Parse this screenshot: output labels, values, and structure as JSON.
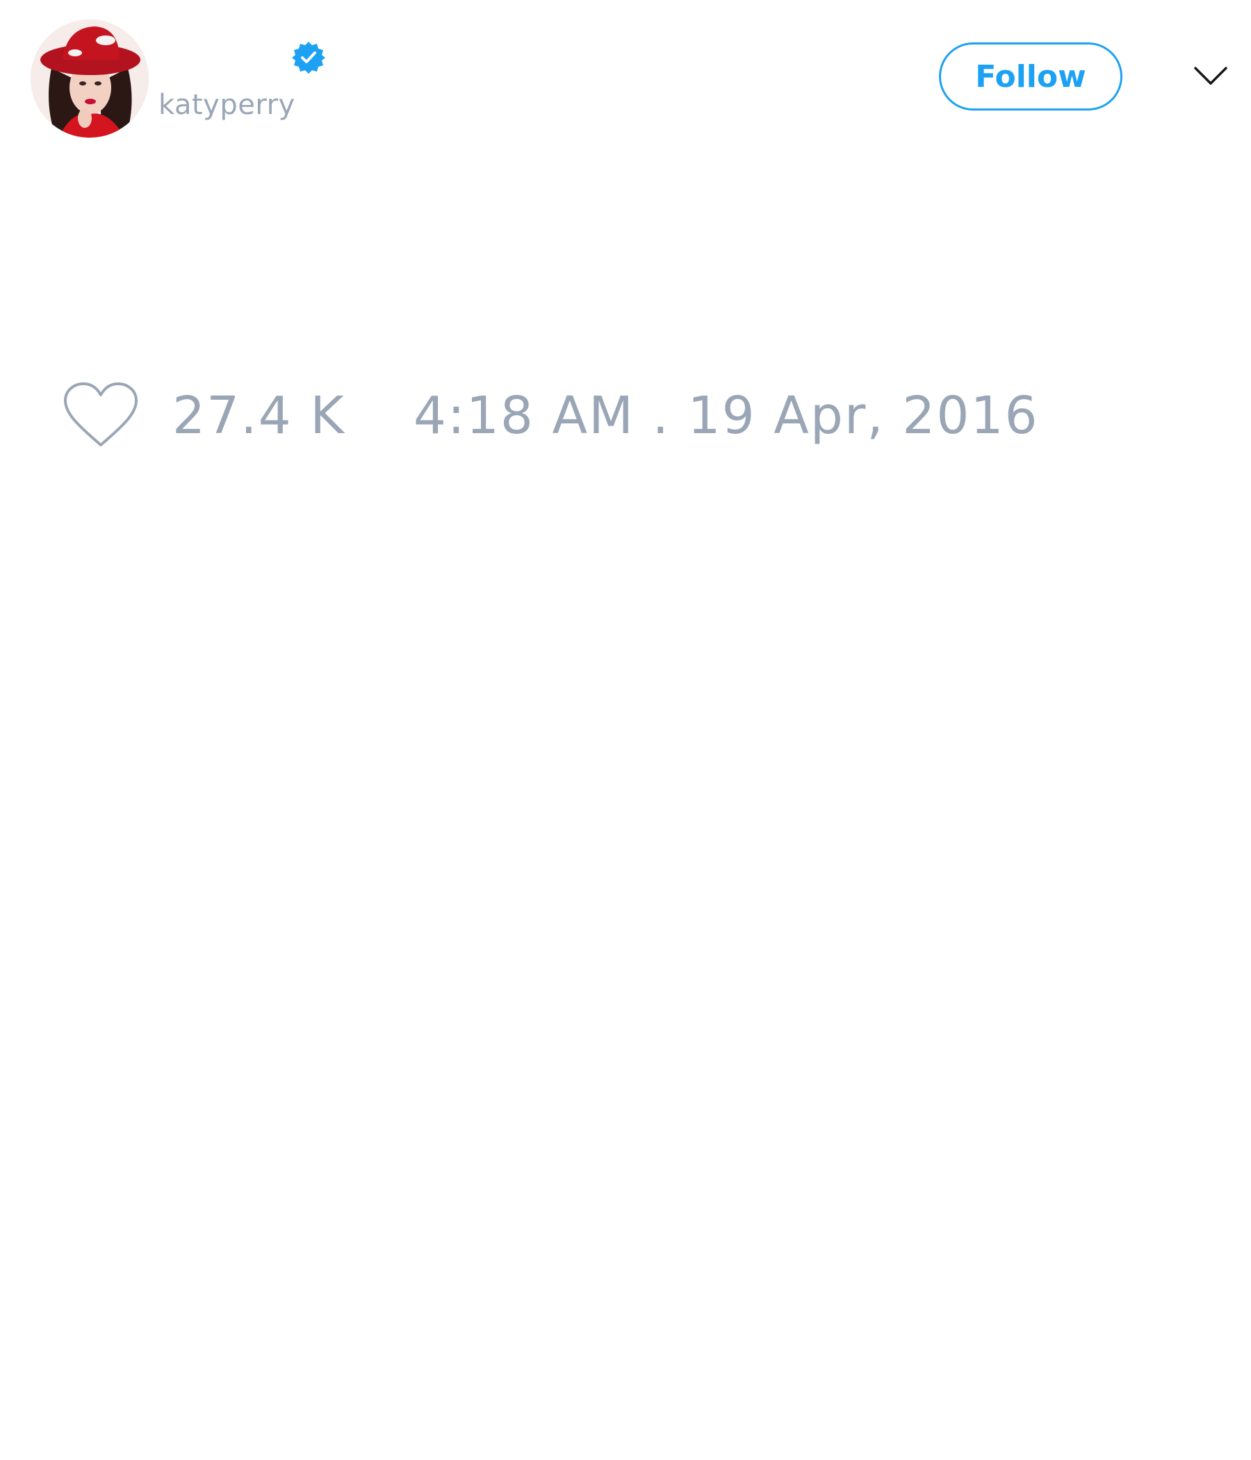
{
  "user": {
    "display_name": "",
    "handle": "katyperry",
    "verified": true,
    "avatar_alt": "profile-photo"
  },
  "actions": {
    "follow_label": "Follow",
    "more_icon": "chevron-down-icon"
  },
  "tweet": {
    "text": "",
    "like_icon": "heart-outline-icon",
    "like_count": "27.4 K",
    "timestamp": "4:18 AM . 19 Apr, 2016"
  },
  "colors": {
    "accent": "#1da1f2",
    "muted_text": "#9aa6b6",
    "background": "#ffffff"
  }
}
